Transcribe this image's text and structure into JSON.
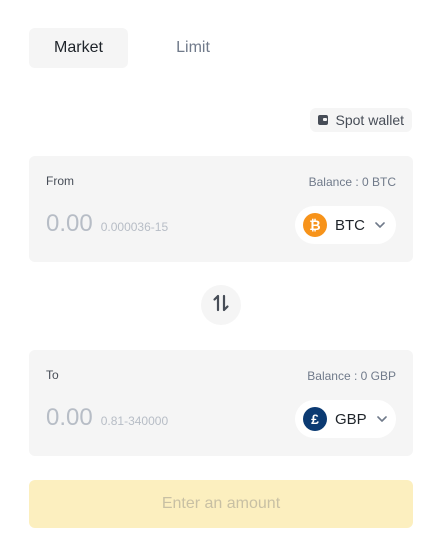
{
  "tabs": {
    "market": "Market",
    "limit": "Limit"
  },
  "wallet": {
    "label": "Spot wallet",
    "icon": "wallet-icon"
  },
  "from": {
    "label": "From",
    "balance": "Balance : 0 BTC",
    "amount": "0.00",
    "range": "0.000036-15",
    "coin": {
      "symbol": "BTC",
      "logo_glyph": "₿",
      "color": "#f7931a"
    }
  },
  "to": {
    "label": "To",
    "balance": "Balance : 0 GBP",
    "amount": "0.00",
    "range": "0.81-340000",
    "coin": {
      "symbol": "GBP",
      "logo_glyph": "£",
      "color": "#0b3a72"
    }
  },
  "swap": {
    "icon": "swap-vertical-icon"
  },
  "submit": {
    "label": "Enter an amount",
    "disabled": true
  },
  "colors": {
    "accent_disabled": "#fcefbf",
    "panel_bg": "#f5f5f5"
  }
}
